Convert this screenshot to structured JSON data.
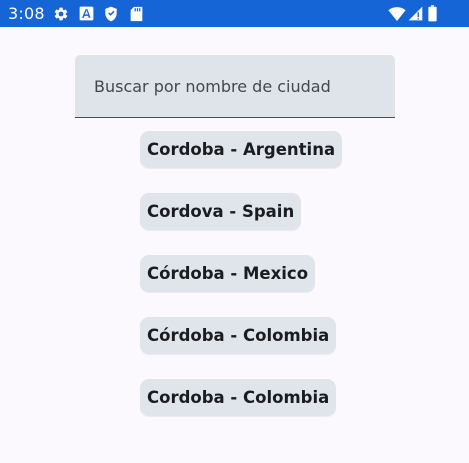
{
  "status_bar": {
    "time": "3:08",
    "background": "#1565d6",
    "left_icons": [
      "gear-icon",
      "font-a-icon",
      "shield-icon",
      "sd-card-icon"
    ],
    "right_icons": [
      "wifi-icon",
      "cell-signal-icon",
      "battery-icon"
    ]
  },
  "search": {
    "placeholder": "Buscar por nombre de ciudad",
    "value": ""
  },
  "results": [
    {
      "label": "Cordoba - Argentina"
    },
    {
      "label": "Cordova - Spain"
    },
    {
      "label": "Córdoba - Mexico"
    },
    {
      "label": "Córdoba - Colombia"
    },
    {
      "label": "Cordoba - Colombia"
    }
  ],
  "colors": {
    "page_background": "#fbf9fe",
    "chip_background": "#e0e4eb",
    "search_background": "#dfe3ea",
    "text": "#1b1c20"
  }
}
